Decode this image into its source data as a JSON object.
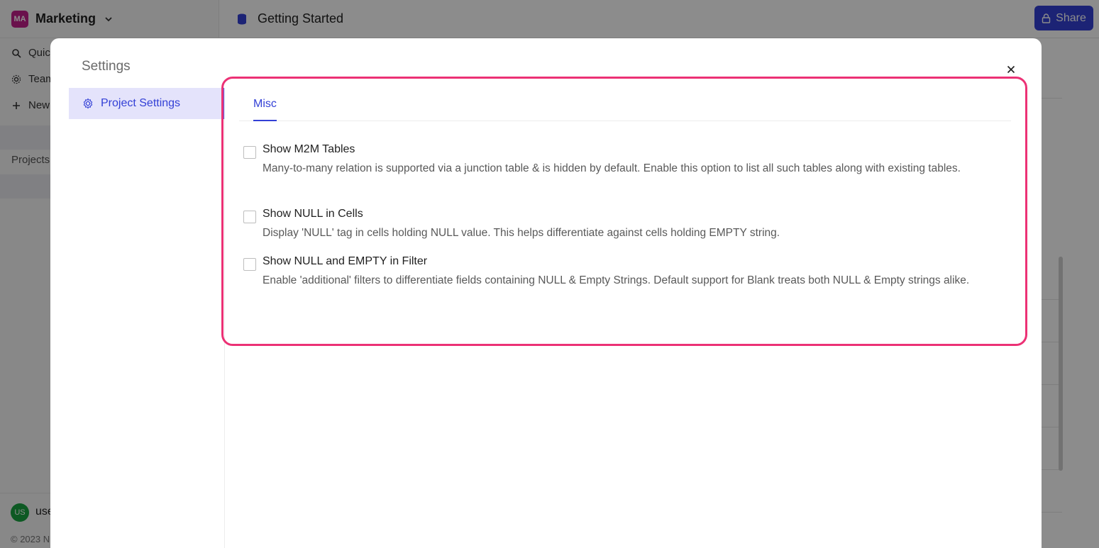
{
  "workspace": {
    "badge": "MA",
    "name": "Marketing"
  },
  "sidebar": {
    "items": [
      {
        "label": "Quick Access",
        "icon": "search-icon"
      },
      {
        "label": "Team & Settings",
        "icon": "gear-icon"
      },
      {
        "label": "New Project",
        "icon": "plus-icon"
      }
    ],
    "section_label": "Projects",
    "user_badge": "US",
    "user_label": "user",
    "footer_text": "© 2023 N"
  },
  "topbar": {
    "title": "Getting Started",
    "share_label": "Share"
  },
  "modal": {
    "title": "Settings",
    "menu": [
      {
        "label": "Project Settings",
        "icon": "gear-icon"
      }
    ],
    "tabs": [
      {
        "label": "Misc"
      }
    ],
    "options": [
      {
        "title": "Show M2M Tables",
        "description": "Many-to-many relation is supported via a junction table & is hidden by default. Enable this option to list all such tables along with existing tables.",
        "checked": false
      },
      {
        "title": "Show NULL in Cells",
        "description": "Display 'NULL' tag in cells holding NULL value. This helps differentiate against cells holding EMPTY string.",
        "checked": false
      },
      {
        "title": "Show NULL and EMPTY in Filter",
        "description": "Enable 'additional' filters to differentiate fields containing NULL & Empty Strings. Default support for Blank treats both NULL & Empty strings alike.",
        "checked": false
      }
    ]
  },
  "colors": {
    "accent": "#3340d6",
    "highlight_border": "#ec3175",
    "menu_active_bg": "#e4e3fb"
  }
}
